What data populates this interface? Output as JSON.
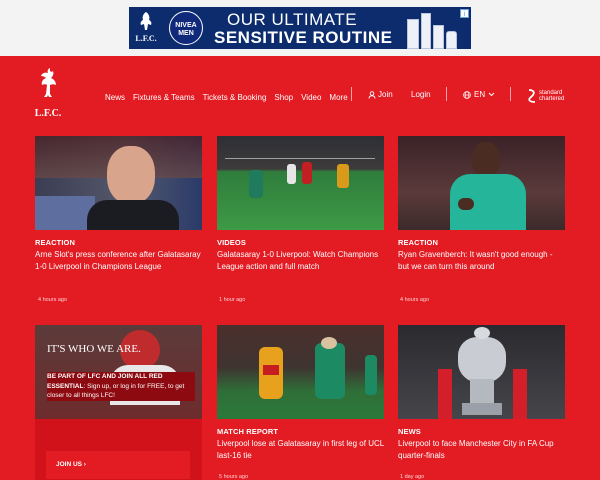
{
  "ad": {
    "lfc_label": "L.F.C.",
    "brand": "NIVEA MEN",
    "line1": "OUR ULTIMATE",
    "line2": "SENSITIVE ROUTINE",
    "info_glyph": "i"
  },
  "header": {
    "logo_text": "L.F.C.",
    "nav": [
      "News",
      "Fixtures & Teams",
      "Tickets & Booking",
      "Shop",
      "Video",
      "More"
    ],
    "join": "Join",
    "login": "Login",
    "language": "EN",
    "sponsor_line1": "standard",
    "sponsor_line2": "chartered"
  },
  "articles": [
    {
      "category": "REACTION",
      "title": "Arne Slot's press conference after Galatasaray 1-0 Liverpool in Champions League",
      "time": "4 hours ago"
    },
    {
      "category": "VIDEOS",
      "title": "Galatasaray 1-0 Liverpool: Watch Champions League action and full match",
      "time": "1 hour ago"
    },
    {
      "category": "REACTION",
      "title": "Ryan Gravenberch: It wasn't good enough - but we can turn this around",
      "time": "4 hours ago"
    },
    {
      "category": "MATCH REPORT",
      "title": "Liverpool lose at Galatasaray in first leg of UCL last-16 tie",
      "time": "5 hours ago"
    },
    {
      "category": "NEWS",
      "title": "Liverpool to face Manchester City in FA Cup quarter-finals",
      "time": "1 day ago"
    }
  ],
  "promo": {
    "image_text": "IT'S WHO WE ARE.",
    "heading": "BE PART OF LFC AND JOIN ALL RED ESSENTIAL",
    "body": ": Sign up, or log in for FREE, to get closer to all things LFC!",
    "button": "JOIN US ›"
  },
  "colors": {
    "brand_red": "#e31b23",
    "ad_navy": "#0c2c6e"
  }
}
